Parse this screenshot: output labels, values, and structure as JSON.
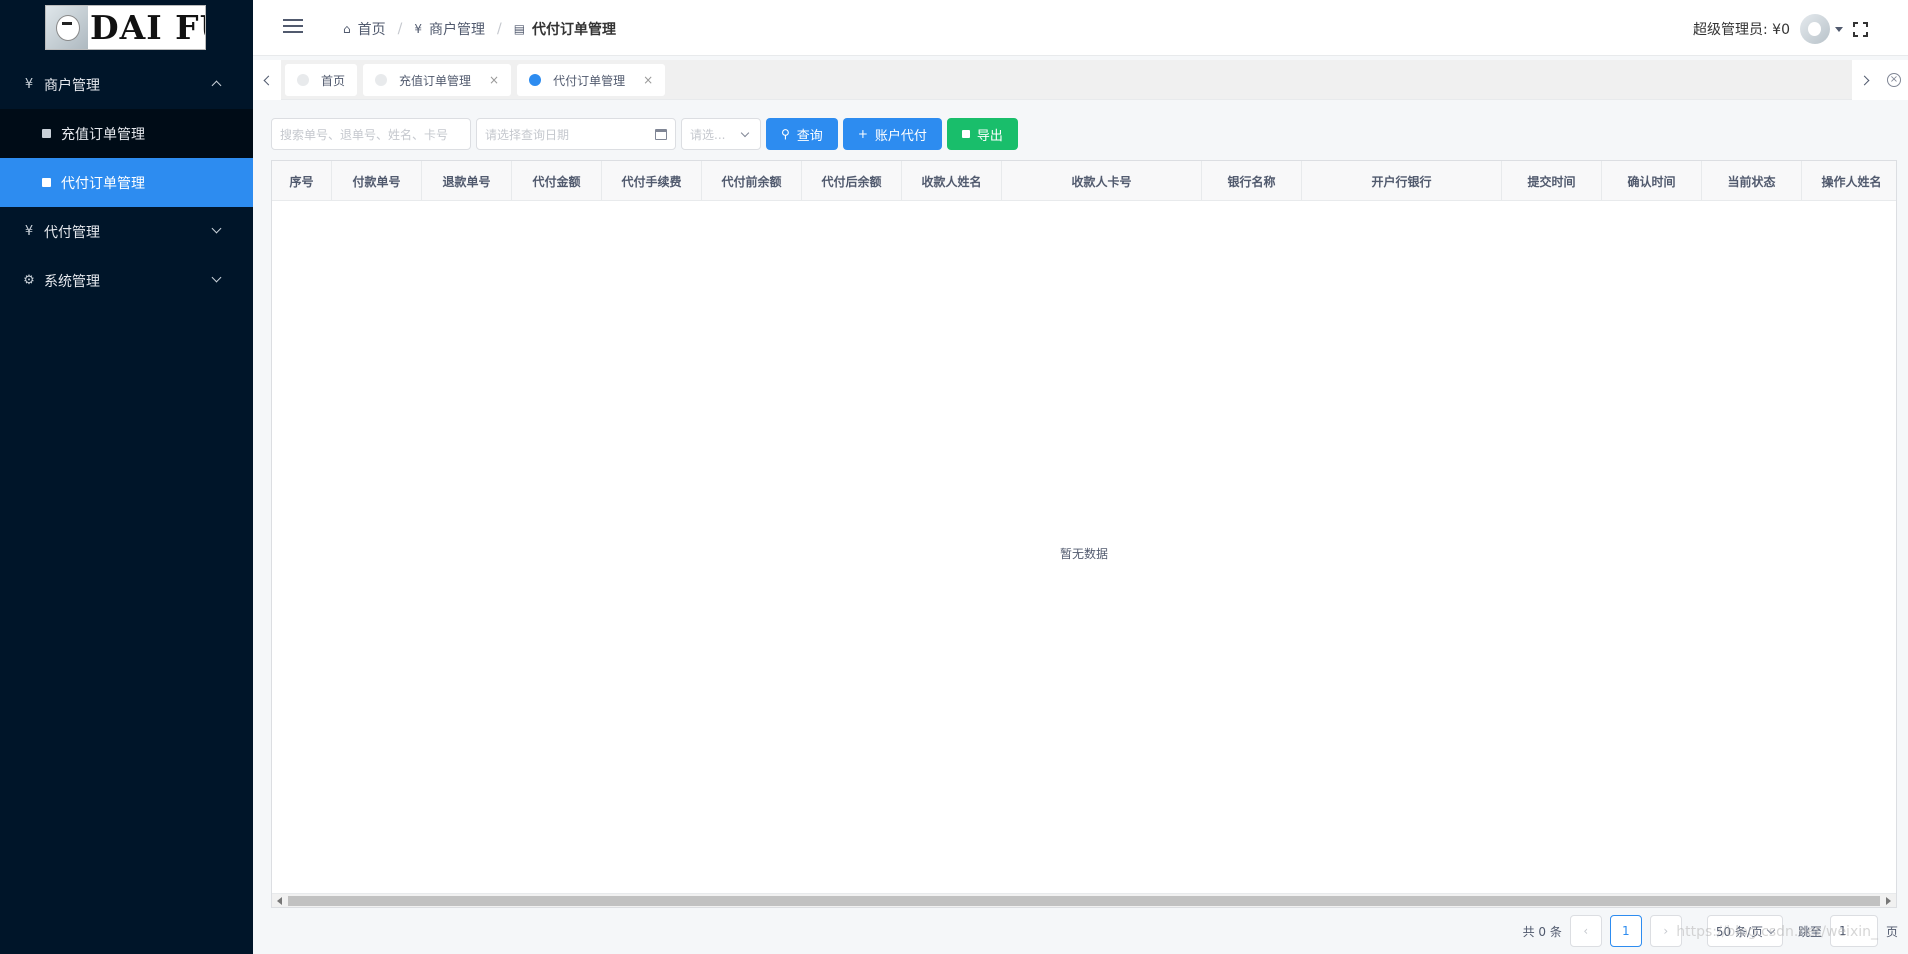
{
  "logo": {
    "text": "DAI FU"
  },
  "sidebar": {
    "menu_merchant": {
      "icon": "¥",
      "label": "商户管理"
    },
    "sub_items": [
      {
        "label": "充值订单管理"
      },
      {
        "label": "代付订单管理"
      }
    ],
    "menu_payout": {
      "icon": "¥",
      "label": "代付管理"
    },
    "menu_system": {
      "icon": "⚙",
      "label": "系统管理"
    }
  },
  "header": {
    "breadcrumb": [
      {
        "icon": "⌂",
        "label": "首页"
      },
      {
        "icon": "¥",
        "label": "商户管理"
      },
      {
        "icon": "▤",
        "label": "代付订单管理"
      }
    ],
    "separator": "/",
    "user_label": "超级管理员: ¥0"
  },
  "tabs": [
    {
      "label": "首页",
      "active": false
    },
    {
      "label": "充值订单管理",
      "active": false,
      "close": "×"
    },
    {
      "label": "代付订单管理",
      "active": true,
      "close": "×"
    }
  ],
  "tab_close_all": "×",
  "toolbar": {
    "search_placeholder": "搜索单号、退单号、姓名、卡号",
    "date_placeholder": "请选择查询日期",
    "select_placeholder": "请选...",
    "query_icon": "⚲",
    "query_label": "查询",
    "payout_icon": "+",
    "payout_label": "账户代付",
    "export_label": "导出"
  },
  "table": {
    "columns": [
      "序号",
      "付款单号",
      "退款单号",
      "代付金额",
      "代付手续费",
      "代付前余额",
      "代付后余额",
      "收款人姓名",
      "收款人卡号",
      "银行名称",
      "开户行银行",
      "提交时间",
      "确认时间",
      "当前状态",
      "操作人姓名"
    ],
    "empty_text": "暂无数据"
  },
  "pagination": {
    "total_label": "共 0 条",
    "current_page": "1",
    "page_size": "50 条/页",
    "jump_label": "跳至",
    "jump_value": "1",
    "page_suffix": "页"
  },
  "watermark": "https://blog.csdn.net/weixin_"
}
